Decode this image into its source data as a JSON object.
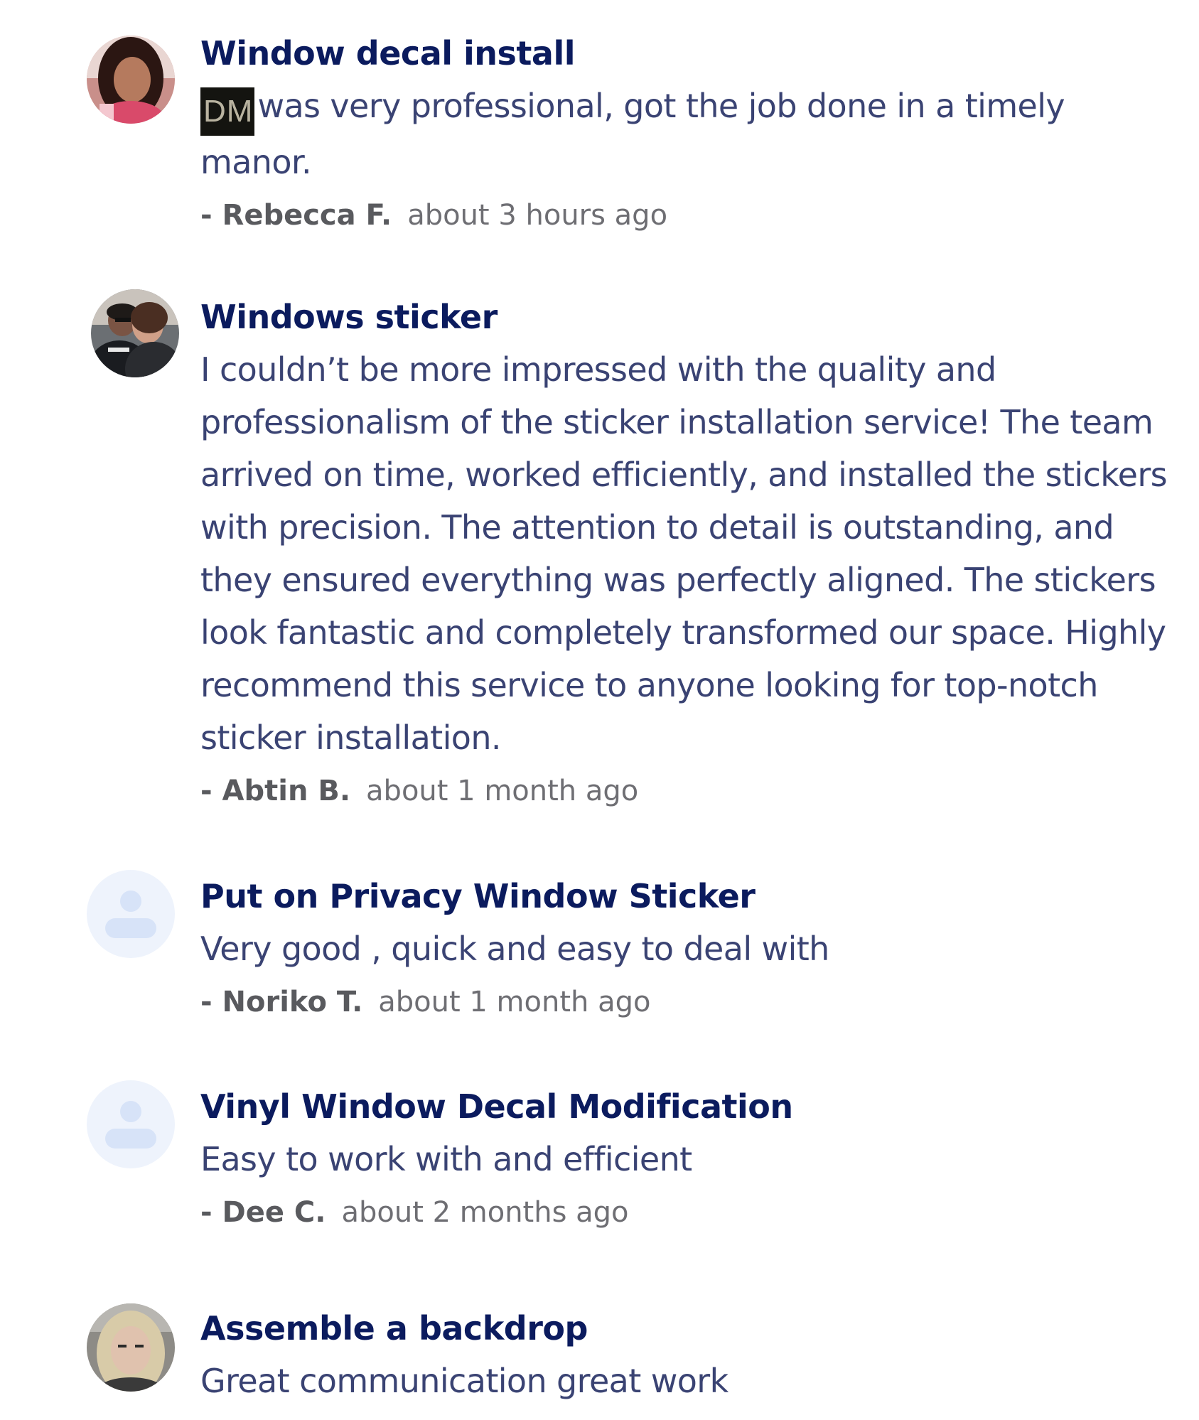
{
  "reviews": [
    {
      "title": "Window decal install",
      "redacted_name": "DM",
      "text": "was very professional, got the job done in a timely manor.",
      "author": "- Rebecca F.",
      "time": "about 3 hours ago",
      "avatar": "photo"
    },
    {
      "title": "Windows sticker",
      "text": "I couldn’t be more impressed with the quality and professionalism of the sticker installation service! The team arrived on time, worked efficiently, and installed the stickers with precision. The attention to detail is outstanding, and they ensured everything was perfectly aligned. The stickers look fantastic and completely transformed our space. Highly recommend this service to anyone looking for top-notch sticker installation.",
      "author": "- Abtin B.",
      "time": "about 1 month ago",
      "avatar": "photo"
    },
    {
      "title": "Put on Privacy Window Sticker",
      "text": "Very good , quick and easy to deal with",
      "author": "- Noriko T.",
      "time": "about 1 month ago",
      "avatar": "default-user-icon"
    },
    {
      "title": "Vinyl Window Decal Modification",
      "text": "Easy to work with and efficient",
      "author": "- Dee C.",
      "time": "about 2 months ago",
      "avatar": "default-user-icon"
    },
    {
      "title": "Assemble a backdrop",
      "text": "Great communication great work",
      "author": "",
      "time": "",
      "avatar": "photo"
    }
  ],
  "colors": {
    "title": "#0b1b5e",
    "body": "#3a4373",
    "meta": "#6e6e73",
    "placeholder_bg": "#eef3fc",
    "placeholder_icon": "#d7e3f8"
  }
}
